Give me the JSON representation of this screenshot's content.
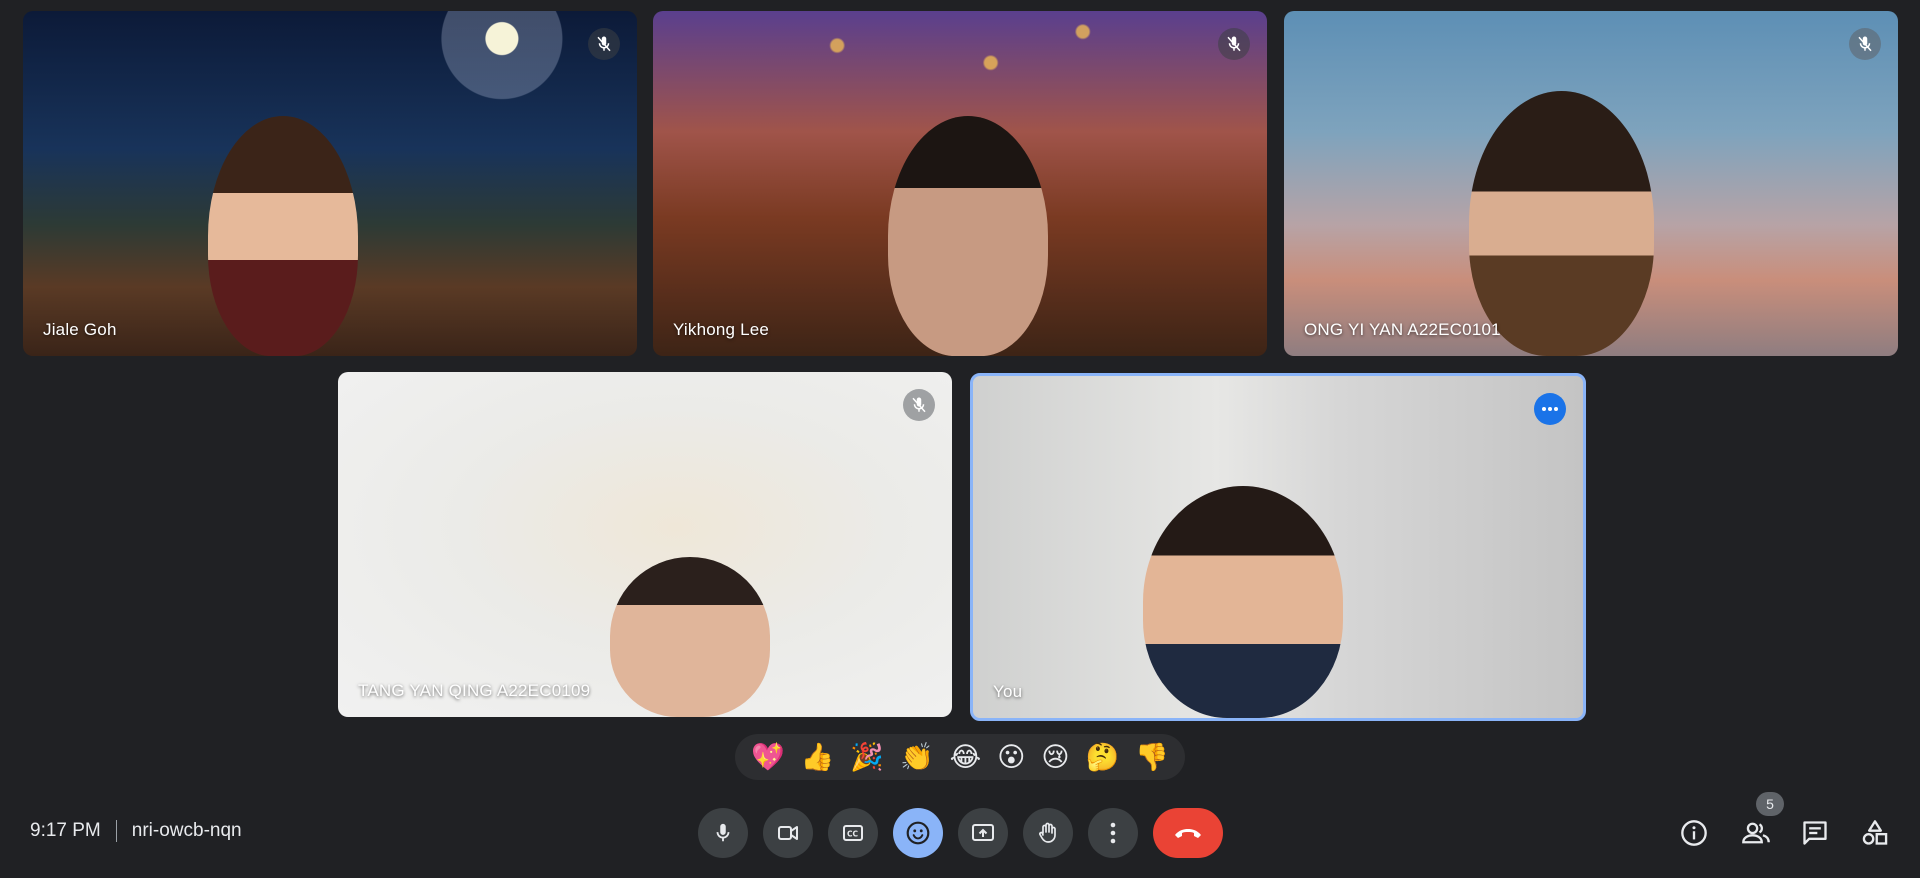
{
  "tiles": [
    {
      "name": "Jiale Goh",
      "muted": true
    },
    {
      "name": "Yikhong Lee",
      "muted": true
    },
    {
      "name": "ONG YI YAN A22EC0101",
      "muted": true
    },
    {
      "name": "TANG YAN QING A22EC0109",
      "muted": true
    },
    {
      "name": "You",
      "muted": false
    }
  ],
  "reactions": [
    "💖",
    "👍",
    "🎉",
    "👏",
    "😂",
    "😮",
    "😢",
    "🤔",
    "👎"
  ],
  "meeting": {
    "time": "9:17 PM",
    "code": "nri-owcb-nqn"
  },
  "people_count": "5",
  "colors": {
    "background": "#202124",
    "control": "#3c4043",
    "active": "#8ab4f8",
    "end_call": "#ea4335",
    "accent": "#1a73e8"
  }
}
